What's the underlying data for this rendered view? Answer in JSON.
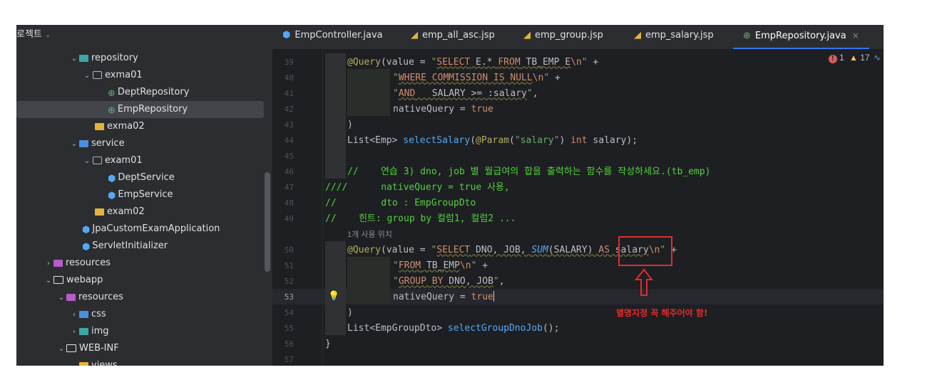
{
  "project": {
    "header_label": "로젝트",
    "items": [
      {
        "label": "repository"
      },
      {
        "label": "exma01"
      },
      {
        "label": "DeptRepository"
      },
      {
        "label": "EmpRepository"
      },
      {
        "label": "exma02"
      },
      {
        "label": "service"
      },
      {
        "label": "exam01"
      },
      {
        "label": "DeptService"
      },
      {
        "label": "EmpService"
      },
      {
        "label": "exam02"
      },
      {
        "label": "JpaCustomExamApplication"
      },
      {
        "label": "ServletInitializer"
      },
      {
        "label": "resources"
      },
      {
        "label": "webapp"
      },
      {
        "label": "resources"
      },
      {
        "label": "css"
      },
      {
        "label": "img"
      },
      {
        "label": "WEB-INF"
      },
      {
        "label": "views"
      }
    ]
  },
  "tabs": [
    {
      "label": "EmpController.java",
      "icon": "java-class-icon"
    },
    {
      "label": "emp_all_asc.jsp",
      "icon": "jsp-icon"
    },
    {
      "label": "emp_group.jsp",
      "icon": "jsp-icon"
    },
    {
      "label": "emp_salary.jsp",
      "icon": "jsp-icon"
    },
    {
      "label": "EmpRepository.java",
      "icon": "interface-icon",
      "active": true,
      "close": "×"
    }
  ],
  "editor": {
    "line_numbers": [
      "39",
      "40",
      "41",
      "42",
      "43",
      "44",
      "45",
      "46",
      "47",
      "48",
      "49",
      "50",
      "51",
      "52",
      "53",
      "54",
      "55",
      "56",
      "57"
    ],
    "current_line": "53",
    "status": {
      "errors": "1",
      "warnings": "17"
    },
    "usage_hint": "1개 사용 위치"
  },
  "annotation": {
    "note": "별명지정 꼭 해주어야 함!",
    "color": "#e22c2c"
  },
  "colors": {
    "background": "#1e1f22",
    "sidebar": "#2b2d30",
    "accent": "#3574f0",
    "comment": "#52d140"
  }
}
